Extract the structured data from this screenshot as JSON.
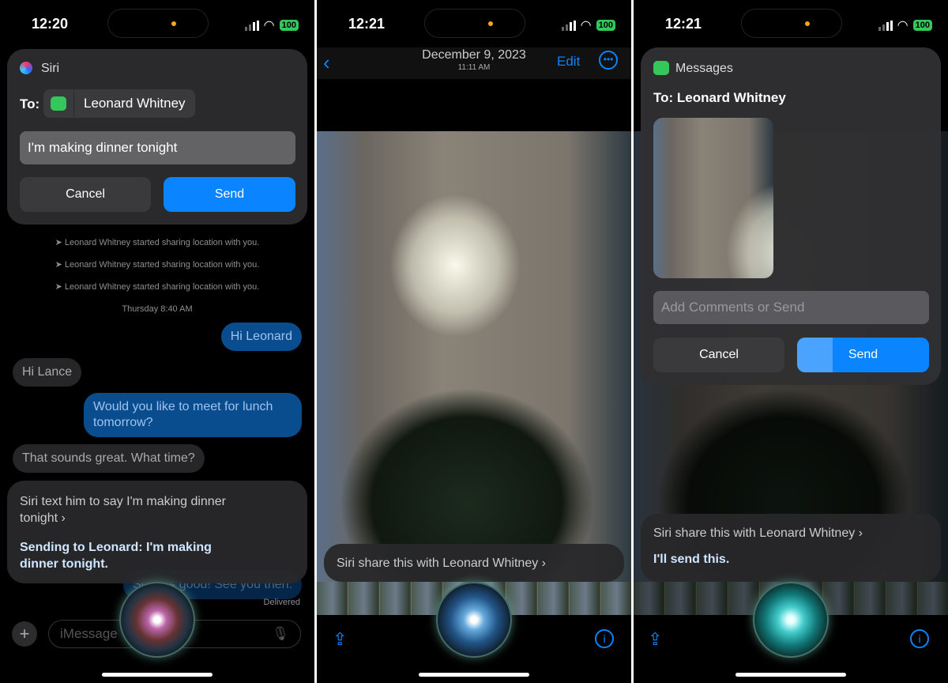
{
  "panel1": {
    "time": "12:20",
    "battery": "100",
    "siri_card": {
      "app": "Siri",
      "to_label": "To:",
      "recipient": "Leonard Whitney",
      "message": "I'm making dinner tonight",
      "cancel": "Cancel",
      "send": "Send"
    },
    "system_messages": [
      "Leonard Whitney started sharing location with you.",
      "Leonard Whitney started sharing location with you.",
      "Leonard Whitney started sharing location with you."
    ],
    "timestamp": "Thursday 8:40 AM",
    "messages": [
      {
        "dir": "out",
        "text": "Hi Leonard"
      },
      {
        "dir": "in",
        "text": "Hi Lance"
      },
      {
        "dir": "out",
        "text": "Would you like to meet for lunch tomorrow?"
      },
      {
        "dir": "in",
        "text": "That sounds great. What time?"
      },
      {
        "dir": "out",
        "text": "Sounds good! See you then."
      }
    ],
    "delivered": "Delivered",
    "siri_prompt": {
      "request": "Siri text him to say I'm making dinner tonight ›",
      "response": "Sending to Leonard: I'm making dinner tonight."
    },
    "input_placeholder": "iMessage"
  },
  "panel2": {
    "time": "12:21",
    "battery": "100",
    "date": "December 9, 2023",
    "subtime": "11:11 AM",
    "edit": "Edit",
    "siri_prompt": "Siri share this with Leonard Whitney ›"
  },
  "panel3": {
    "time": "12:21",
    "battery": "100",
    "app": "Messages",
    "to": "To: Leonard Whitney",
    "comment_placeholder": "Add Comments or Send",
    "cancel": "Cancel",
    "send": "Send",
    "siri_prompt": {
      "request": "Siri share this with Leonard Whitney ›",
      "response": "I'll send this."
    }
  },
  "colors": {
    "accent": "#0a84ff",
    "messages_green": "#34c759"
  }
}
